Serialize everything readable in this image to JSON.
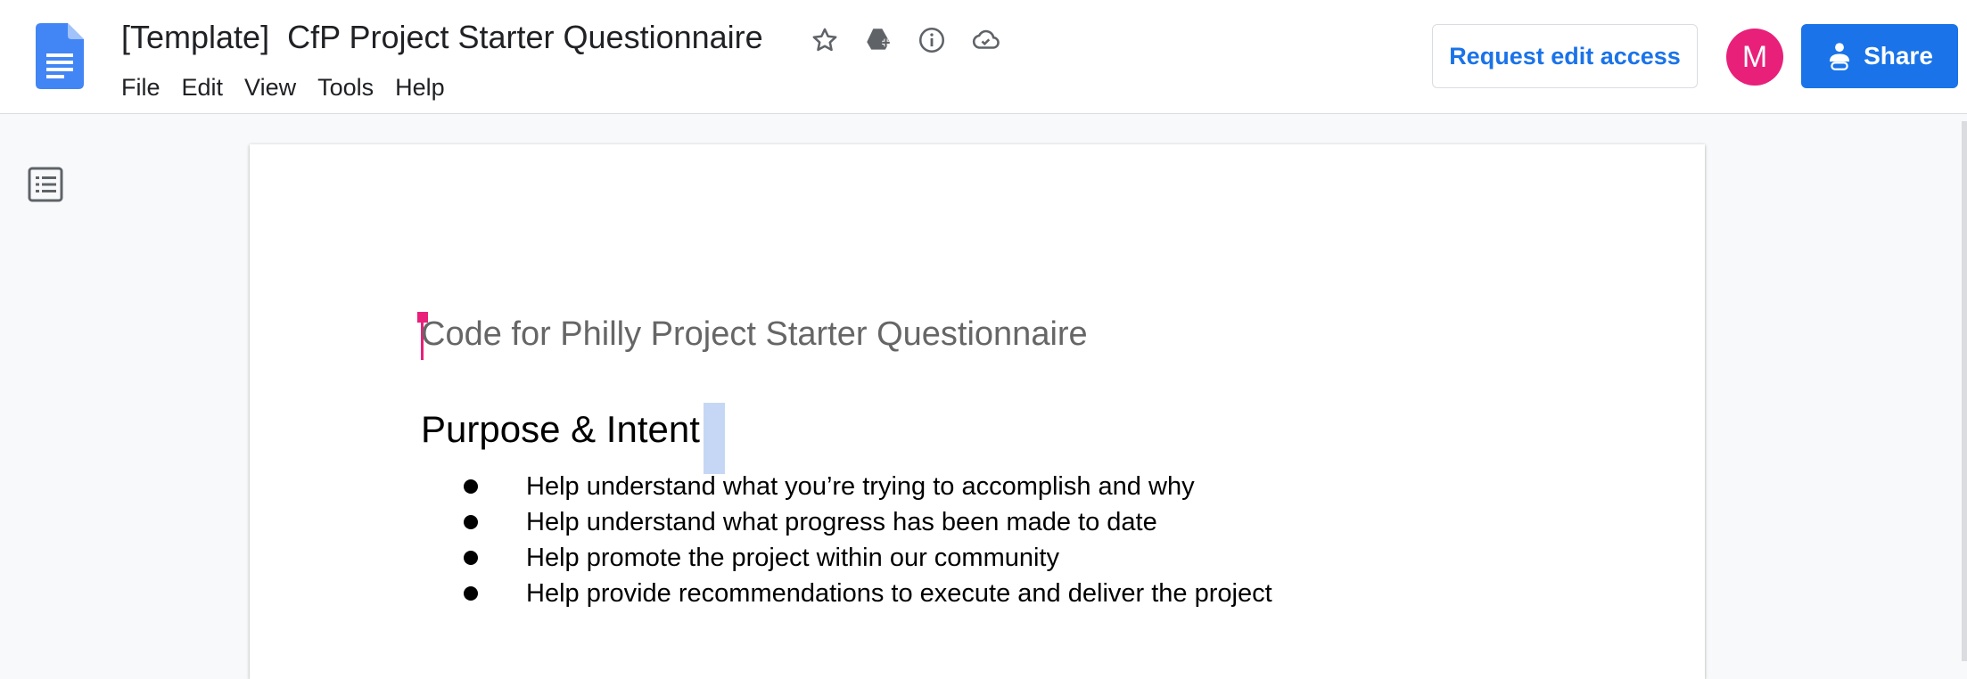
{
  "header": {
    "doc_title": "[Template]  CfP Project Starter Questionnaire",
    "title_icons": [
      "star-icon",
      "move-to-drive-icon",
      "info-icon",
      "cloud-saved-icon"
    ],
    "menu": [
      "File",
      "Edit",
      "View",
      "Tools",
      "Help"
    ],
    "request_edit_label": "Request edit access",
    "avatar_letter": "M",
    "share_label": "Share"
  },
  "colors": {
    "accent": "#1a73e8",
    "avatar": "#e8207a",
    "cursor": "#e8207a",
    "selection": "#c6d7f5"
  },
  "document": {
    "title": "Code for Philly Project Starter Questionnaire",
    "section_heading": "Purpose & Intent",
    "bullets": [
      "Help understand what you’re trying to accomplish and why",
      "Help understand what progress has been made to date",
      "Help promote the project within our community",
      "Help provide recommendations to execute and deliver the project"
    ]
  },
  "sidebar": {
    "outline_icon": "document-outline-icon"
  }
}
